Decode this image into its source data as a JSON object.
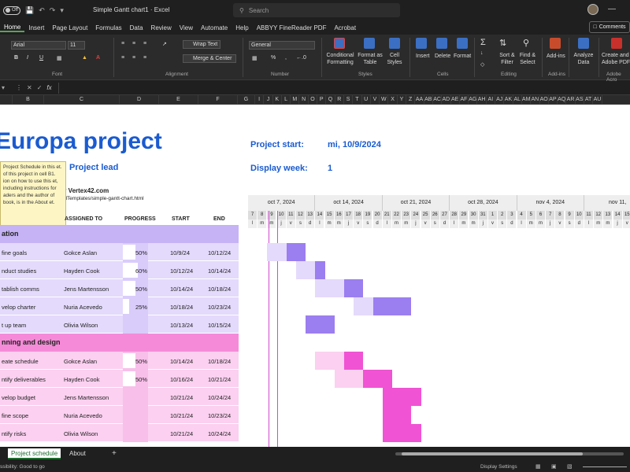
{
  "titlebar": {
    "autosave": "Off",
    "doc_title": "Simple Gantt chart1  ·  Excel",
    "search_placeholder": "Search"
  },
  "menu": [
    "Home",
    "Insert",
    "Page Layout",
    "Formulas",
    "Data",
    "Review",
    "View",
    "Automate",
    "Help",
    "ABBYY FineReader PDF",
    "Acrobat"
  ],
  "comments_label": "Comments",
  "ribbon": {
    "font_name": "Arial",
    "font_size": "11",
    "number_format": "General",
    "wrap_text": "Wrap Text",
    "merge_center": "Merge & Center",
    "cond_format": "Conditional Formatting",
    "format_table": "Format as Table",
    "cell_styles": "Cell Styles",
    "insert": "Insert",
    "delete": "Delete",
    "format": "Format",
    "sort_filter": "Sort & Filter",
    "find_select": "Find & Select",
    "addins": "Add-ins",
    "analyze": "Analyze Data",
    "create_pdf": "Create and Adobe PDF",
    "groups": {
      "font": "Font",
      "alignment": "Alignment",
      "number": "Number",
      "styles": "Styles",
      "cells": "Cells",
      "editing": "Editing",
      "addins": "Add-ins",
      "adobe": "Adobe Acro"
    }
  },
  "formula_bar": {
    "fx": "fx",
    "value": ""
  },
  "columns": [
    "B",
    "C",
    "D",
    "E",
    "F",
    "G",
    "I",
    "J",
    "K",
    "L",
    "M",
    "N",
    "O",
    "P",
    "Q",
    "R",
    "S",
    "T",
    "U",
    "V",
    "W",
    "X",
    "Y",
    "Z",
    "AA",
    "AB",
    "AC",
    "AD",
    "AE",
    "AF",
    "AG",
    "AH",
    "AI",
    "AJ",
    "AK",
    "AL",
    "AM",
    "AN",
    "AO",
    "AP",
    "AQ",
    "AR",
    "AS",
    "AT",
    "AU"
  ],
  "project": {
    "title": "Europa project",
    "lead_label": "Project lead",
    "start_label": "Project start:",
    "start_value": "mi, 10/9/2024",
    "week_label": "Display week:",
    "week_value": "1",
    "byline": "y Vertex42.com",
    "url": "elTemplates/simple-gantt-chart.html"
  },
  "tooltip": "Project Schedule in this et. of this project in cell B1. ion on how to use this et, including instructions for aders and the author of book, is in the About et.",
  "table_headers": {
    "assigned": "ASSIGNED TO",
    "progress": "PROGRESS",
    "start": "START",
    "end": "END"
  },
  "phases": [
    {
      "name": "ation",
      "color": "#c5b3f5"
    },
    {
      "name": "nning and design",
      "color": "#f58bd8"
    }
  ],
  "tasks": [
    {
      "task": "fine goals",
      "assigned": "Gokce Aslan",
      "progress": "50%",
      "start": "10/9/24",
      "end": "10/12/24"
    },
    {
      "task": "nduct studies",
      "assigned": "Hayden Cook",
      "progress": "60%",
      "start": "10/12/24",
      "end": "10/14/24"
    },
    {
      "task": "tablish comms",
      "assigned": "Jens Martensson",
      "progress": "50%",
      "start": "10/14/24",
      "end": "10/18/24"
    },
    {
      "task": "velop charter",
      "assigned": "Nuria Acevedo",
      "progress": "25%",
      "start": "10/18/24",
      "end": "10/23/24"
    },
    {
      "task": "t up team",
      "assigned": "Olivia Wilson",
      "progress": "",
      "start": "10/13/24",
      "end": "10/15/24"
    },
    {
      "task": "eate schedule",
      "assigned": "Gokce Aslan",
      "progress": "50%",
      "start": "10/14/24",
      "end": "10/18/24"
    },
    {
      "task": "ntify deliverables",
      "assigned": "Hayden Cook",
      "progress": "50%",
      "start": "10/16/24",
      "end": "10/21/24"
    },
    {
      "task": "velop budget",
      "assigned": "Jens Martensson",
      "progress": "",
      "start": "10/21/24",
      "end": "10/24/24"
    },
    {
      "task": "fine scope",
      "assigned": "Nuria Acevedo",
      "progress": "",
      "start": "10/21/24",
      "end": "10/23/24"
    },
    {
      "task": "ntify risks",
      "assigned": "Olivia Wilson",
      "progress": "",
      "start": "10/21/24",
      "end": "10/24/24"
    }
  ],
  "gantt": {
    "weeks": [
      "oct 7, 2024",
      "oct 14, 2024",
      "oct 21, 2024",
      "oct 28, 2024",
      "nov 4, 2024",
      "nov 11,"
    ],
    "day_numbers": [
      "7",
      "8",
      "9",
      "10",
      "11",
      "12",
      "13",
      "14",
      "15",
      "16",
      "17",
      "18",
      "19",
      "20",
      "21",
      "22",
      "23",
      "24",
      "25",
      "26",
      "27",
      "28",
      "29",
      "30",
      "31",
      "1",
      "2",
      "3",
      "4",
      "5",
      "6",
      "7",
      "8",
      "9",
      "10",
      "11",
      "12",
      "13",
      "14",
      "15"
    ],
    "day_letters": [
      "l",
      "m",
      "m",
      "j",
      "v",
      "s",
      "d",
      "l",
      "m",
      "m",
      "j",
      "v",
      "s",
      "d",
      "l",
      "m",
      "m",
      "j",
      "v",
      "s",
      "d",
      "l",
      "m",
      "m",
      "j",
      "v",
      "s",
      "d",
      "l",
      "m",
      "m",
      "j",
      "v",
      "s",
      "d",
      "l",
      "m",
      "m",
      "j",
      "v"
    ]
  },
  "sheet_tabs": [
    "Project schedule",
    "About"
  ],
  "status": {
    "accessibility": "ssibility: Good to go",
    "display_settings": "Display Settings"
  }
}
